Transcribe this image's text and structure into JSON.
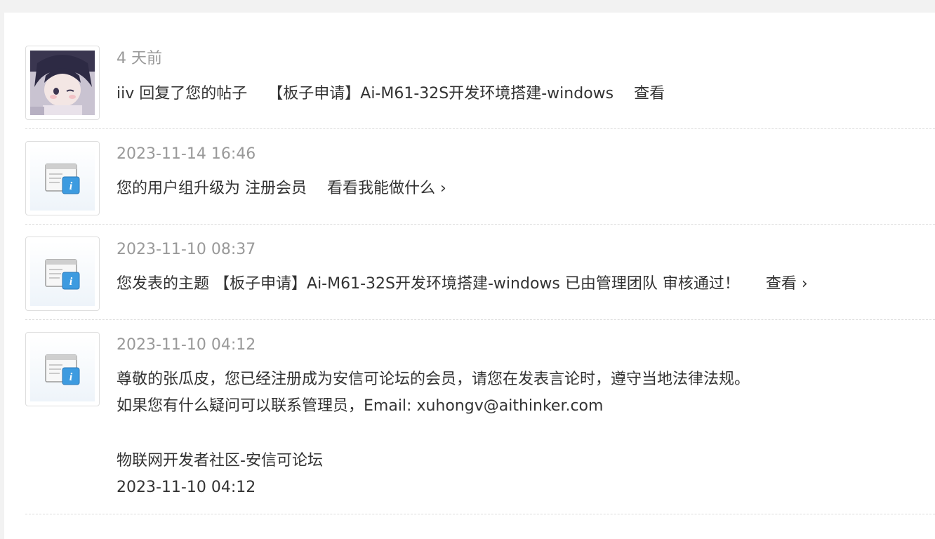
{
  "notices": [
    {
      "time": "4 天前",
      "user": "iiv",
      "action": "回复了您的帖子",
      "thread": "【板子申请】Ai-M61-32S开发环境搭建-windows",
      "view_label": "查看",
      "avatar_icon": "user-avatar"
    },
    {
      "time": "2023-11-14 16:46",
      "text": "您的用户组升级为",
      "group": "注册会员",
      "link_label": "看看我能做什么 ›",
      "icon": "system-info-icon"
    },
    {
      "time": "2023-11-10 08:37",
      "prefix": "您发表的主题",
      "thread": "【板子申请】Ai-M61-32S开发环境搭建-windows",
      "suffix": "已由管理团队",
      "status": "审核通过！",
      "view_label": "查看 ›",
      "icon": "system-info-icon"
    },
    {
      "time": "2023-11-10 04:12",
      "line1": "尊敬的张瓜皮，您已经注册成为安信可论坛的会员，请您在发表言论时，遵守当地法律法规。",
      "line2": "如果您有什么疑问可以联系管理员，Email: xuhongv@aithinker.com",
      "line3": "物联网开发者社区-安信可论坛",
      "line4": "2023-11-10 04:12",
      "icon": "system-info-icon"
    }
  ],
  "colors": {
    "time_gray": "#999999",
    "text": "#333333",
    "info_blue": "#3d9be0"
  }
}
